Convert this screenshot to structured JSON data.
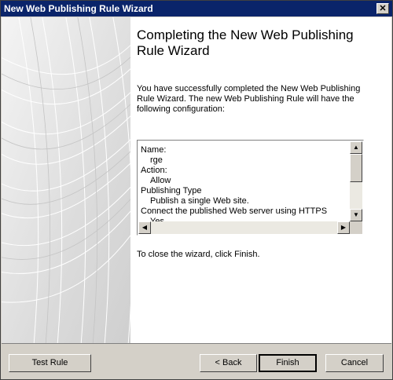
{
  "window": {
    "title": "New Web Publishing Rule Wizard",
    "close_glyph": "✕"
  },
  "heading": "Completing the New Web Publishing Rule Wizard",
  "intro": "You have successfully completed the New Web Publishing Rule Wizard. The new Web Publishing Rule will have the following configuration:",
  "config": {
    "lines": [
      {
        "text": "Name:",
        "indent": false
      },
      {
        "text": "rge",
        "indent": true
      },
      {
        "text": "Action:",
        "indent": false
      },
      {
        "text": "Allow",
        "indent": true
      },
      {
        "text": "Publishing Type",
        "indent": false
      },
      {
        "text": "Publish a single Web site.",
        "indent": true
      },
      {
        "text": "Connect the published Web server using HTTPS",
        "indent": false
      },
      {
        "text": "Yes",
        "indent": true
      }
    ],
    "scroll_up_glyph": "▲",
    "scroll_down_glyph": "▼",
    "scroll_left_glyph": "◀",
    "scroll_right_glyph": "▶"
  },
  "finish_note": "To close the wizard, click Finish.",
  "buttons": {
    "test_rule": "Test Rule",
    "back": "< Back",
    "finish": "Finish",
    "cancel": "Cancel"
  }
}
